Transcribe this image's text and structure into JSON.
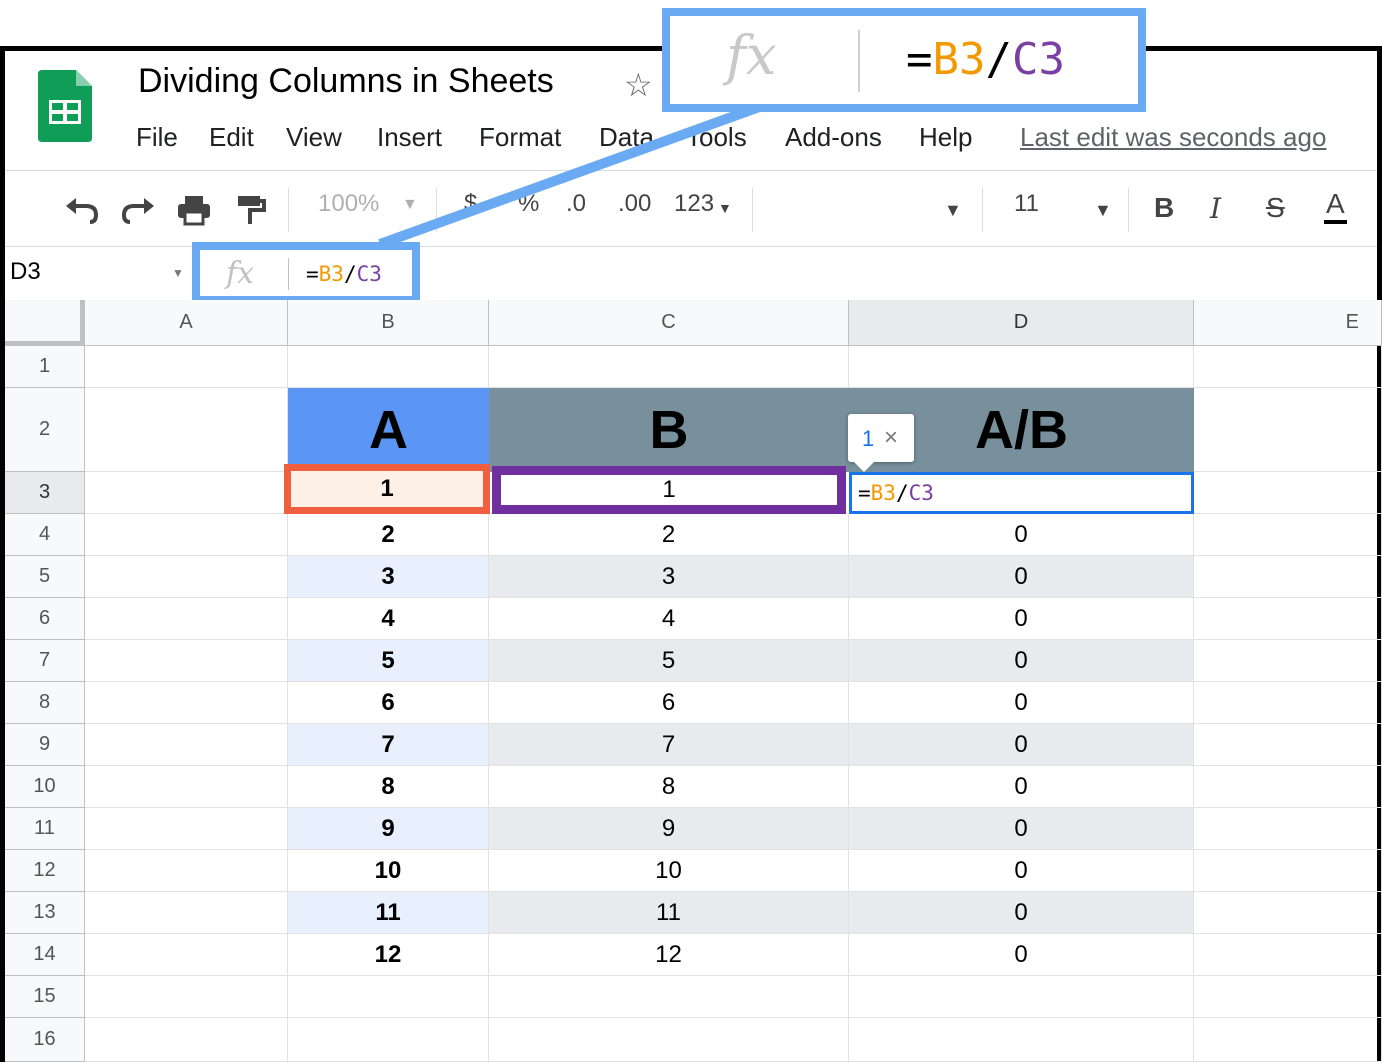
{
  "app": {
    "title": "Dividing Columns in Sheets",
    "star_icon": "star-icon",
    "last_edit": "Last edit was seconds ago",
    "menu": [
      "File",
      "Edit",
      "View",
      "Insert",
      "Format",
      "Data",
      "Tools",
      "Add-ons",
      "Help"
    ]
  },
  "toolbar": {
    "zoom": "100%",
    "currency": "$",
    "percent": "%",
    "decimal_decrease": ".0",
    "decimal_increase": ".00",
    "number_format": "123",
    "font_size": "11",
    "bold": "B",
    "italic": "I",
    "strikethrough": "S",
    "text_color": "A",
    "icons": [
      "undo-icon",
      "redo-icon",
      "print-icon",
      "paint-format-icon",
      "dropdown-arrow-icon"
    ]
  },
  "formula_bar": {
    "cell_ref": "D3",
    "fx": "fx",
    "formula_eq": "=",
    "formula_ref1": "B3",
    "formula_op": "/",
    "formula_ref2": "C3"
  },
  "grid": {
    "columns": [
      "A",
      "B",
      "C",
      "D",
      "E"
    ],
    "rows": [
      "1",
      "2",
      "3",
      "4",
      "5",
      "6",
      "7",
      "8",
      "9",
      "10",
      "11",
      "12",
      "13",
      "14",
      "15",
      "16"
    ],
    "header_row": [
      "A",
      "B",
      "A/B"
    ],
    "data": [
      [
        "1",
        "1",
        ""
      ],
      [
        "2",
        "2",
        "0"
      ],
      [
        "3",
        "3",
        "0"
      ],
      [
        "4",
        "4",
        "0"
      ],
      [
        "5",
        "5",
        "0"
      ],
      [
        "6",
        "6",
        "0"
      ],
      [
        "7",
        "7",
        "0"
      ],
      [
        "8",
        "8",
        "0"
      ],
      [
        "9",
        "9",
        "0"
      ],
      [
        "10",
        "10",
        "0"
      ],
      [
        "11",
        "11",
        "0"
      ],
      [
        "12",
        "12",
        "0"
      ]
    ],
    "tooltip_value": "1",
    "colors": {
      "header_a": "#5b96f5",
      "header_b": "#78909c",
      "band_a": "#e8f0fe",
      "band_b": "#e8eaed",
      "ref1": "#f29900",
      "ref2": "#7b3ea3",
      "highlight_a": "#f06040",
      "highlight_b": "#6f2f9f"
    }
  }
}
